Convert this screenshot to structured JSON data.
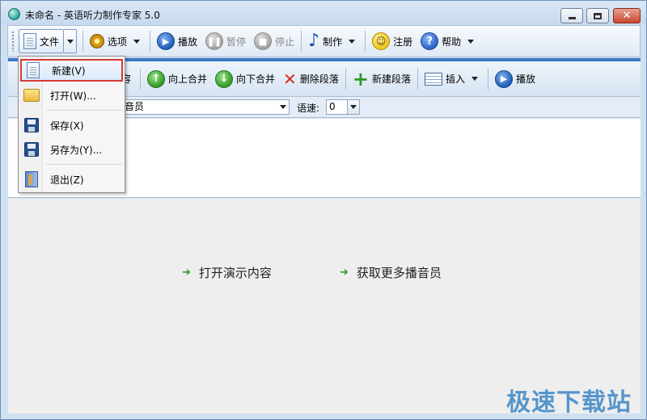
{
  "window": {
    "title": "未命名 - 英语听力制作专家 5.0"
  },
  "toolbar": {
    "file": "文件",
    "options": "选项",
    "play": "播放",
    "pause": "暂停",
    "stop": "停止",
    "make": "制作",
    "register": "注册",
    "help": "帮助"
  },
  "toolbar2": {
    "clipped": "容",
    "merge_up": "向上合并",
    "merge_down": "向下合并",
    "delete_paragraph": "删除段落",
    "new_paragraph": "新建段落",
    "insert": "插入",
    "play": "播放"
  },
  "options_row": {
    "voice_value": "音员",
    "speed_label": "语速:",
    "speed_value": "0"
  },
  "file_menu": {
    "items": [
      {
        "label": "新建(V)",
        "icon": "new-document-icon",
        "highlighted": true
      },
      {
        "label": "打开(W)...",
        "icon": "open-folder-icon"
      },
      {
        "label": "保存(X)",
        "icon": "save-disk-icon"
      },
      {
        "label": "另存为(Y)...",
        "icon": "save-as-disk-icon"
      },
      {
        "label": "退出(Z)",
        "icon": "exit-door-icon"
      }
    ]
  },
  "links": {
    "open_demo": "打开演示内容",
    "more_voices": "获取更多播音员"
  },
  "watermark": "极速下载站",
  "colors": {
    "accent": "#3d78c6",
    "highlight_border": "#d73a36",
    "link_arrow": "#2d9a2a"
  }
}
